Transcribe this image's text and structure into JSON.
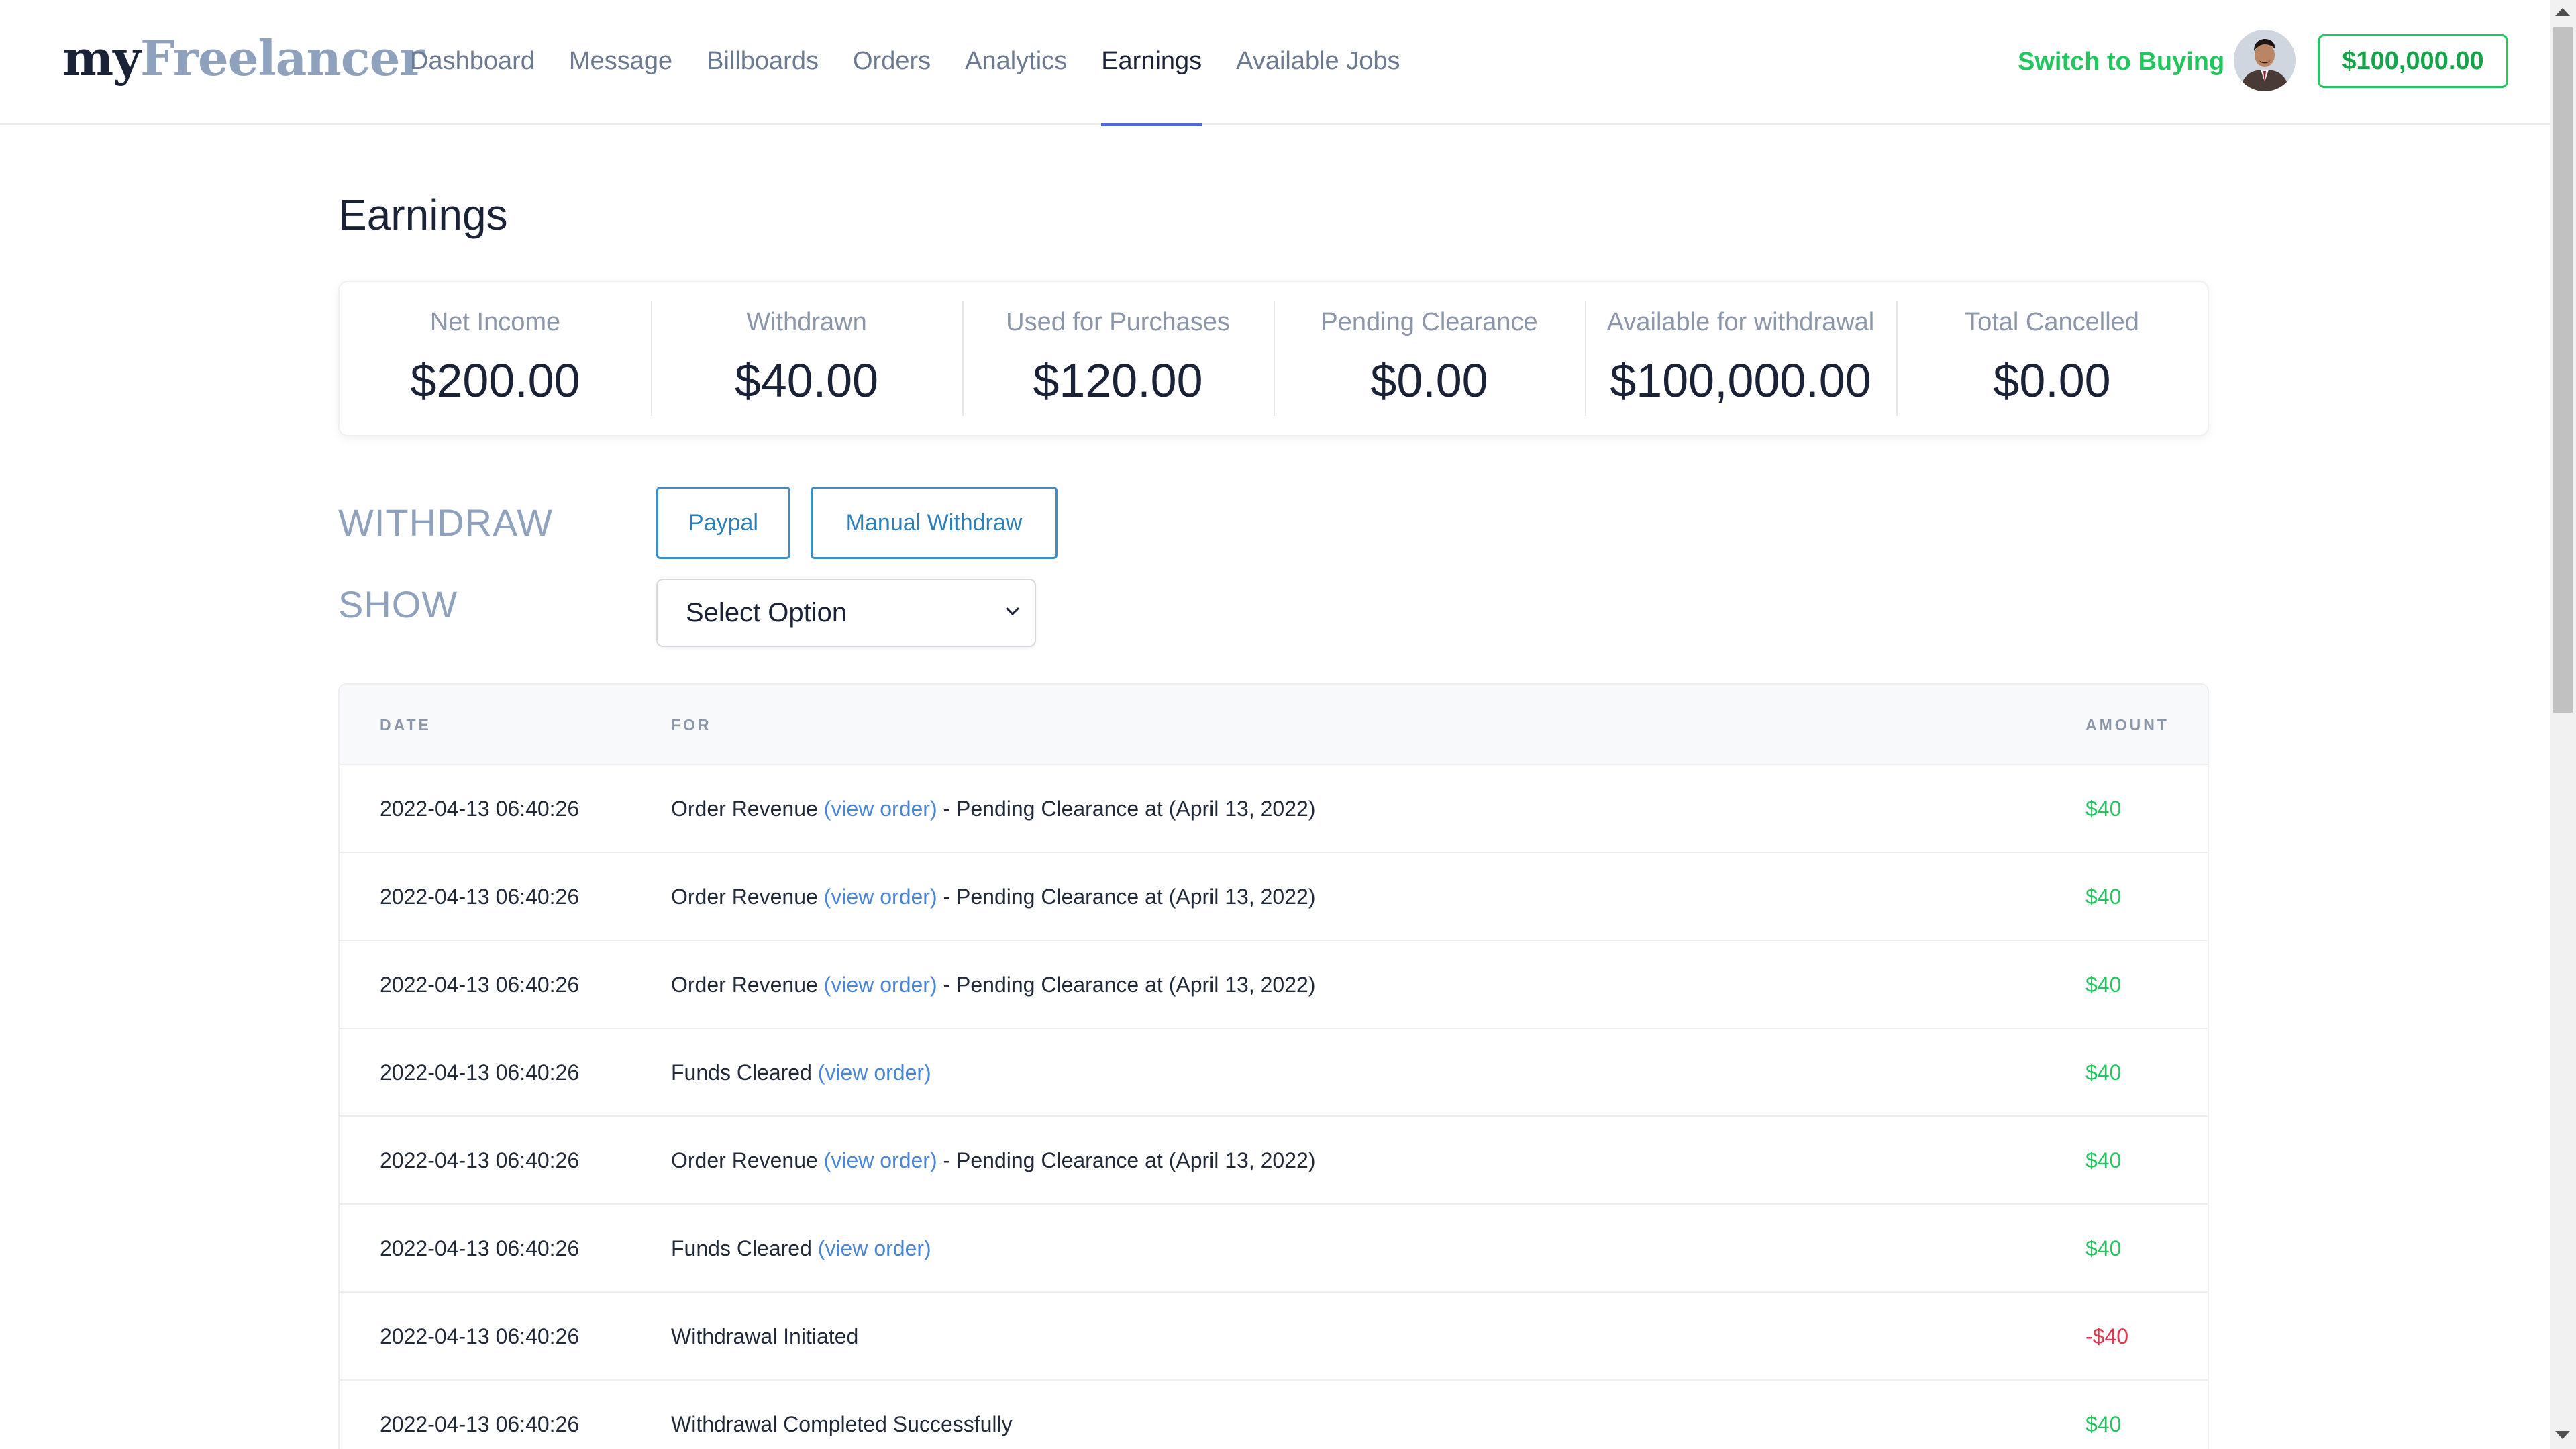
{
  "brand": {
    "my": "my",
    "freelancer": "Freelancer"
  },
  "nav": {
    "items": [
      {
        "label": "Dashboard"
      },
      {
        "label": "Message"
      },
      {
        "label": "Billboards"
      },
      {
        "label": "Orders"
      },
      {
        "label": "Analytics"
      },
      {
        "label": "Earnings",
        "active": true
      },
      {
        "label": "Available Jobs"
      }
    ],
    "switch_label": "Switch to Buying",
    "balance": "$100,000.00"
  },
  "page": {
    "title": "Earnings"
  },
  "stats": [
    {
      "label": "Net Income",
      "value": "$200.00"
    },
    {
      "label": "Withdrawn",
      "value": "$40.00"
    },
    {
      "label": "Used for Purchases",
      "value": "$120.00"
    },
    {
      "label": "Pending Clearance",
      "value": "$0.00"
    },
    {
      "label": "Available for withdrawal",
      "value": "$100,000.00"
    },
    {
      "label": "Total Cancelled",
      "value": "$0.00"
    }
  ],
  "withdraw": {
    "label": "WITHDRAW",
    "paypal_label": "Paypal",
    "manual_label": "Manual Withdraw"
  },
  "show": {
    "label": "SHOW",
    "selected": "Select Option"
  },
  "table": {
    "headers": {
      "date": "DATE",
      "for": "FOR",
      "amount": "AMOUNT"
    },
    "rows": [
      {
        "date": "2022-04-13 06:40:26",
        "text": "Order Revenue ",
        "link": "(view order)",
        "suffix": " - Pending Clearance at (April 13, 2022)",
        "amount": "$40"
      },
      {
        "date": "2022-04-13 06:40:26",
        "text": "Order Revenue ",
        "link": "(view order)",
        "suffix": " - Pending Clearance at (April 13, 2022)",
        "amount": "$40"
      },
      {
        "date": "2022-04-13 06:40:26",
        "text": "Order Revenue ",
        "link": "(view order)",
        "suffix": " - Pending Clearance at (April 13, 2022)",
        "amount": "$40"
      },
      {
        "date": "2022-04-13 06:40:26",
        "text": "Funds Cleared ",
        "link": "(view order)",
        "suffix": "",
        "amount": "$40"
      },
      {
        "date": "2022-04-13 06:40:26",
        "text": "Order Revenue ",
        "link": "(view order)",
        "suffix": " - Pending Clearance at (April 13, 2022)",
        "amount": "$40"
      },
      {
        "date": "2022-04-13 06:40:26",
        "text": "Funds Cleared ",
        "link": "(view order)",
        "suffix": "",
        "amount": "$40"
      },
      {
        "date": "2022-04-13 06:40:26",
        "text": "Withdrawal Initiated",
        "link": "",
        "suffix": "",
        "amount": "-$40"
      },
      {
        "date": "2022-04-13 06:40:26",
        "text": "Withdrawal Completed Successfully",
        "link": "",
        "suffix": "",
        "amount": "$40"
      }
    ]
  },
  "colors": {
    "accent_green": "#22c55e",
    "negative_red": "#e3344e",
    "link_blue": "#4a86d8",
    "nav_active_underline": "#4f6ad6"
  },
  "icons": {
    "avatar": "user-avatar",
    "select_chevron": "chevron-down-icon"
  }
}
